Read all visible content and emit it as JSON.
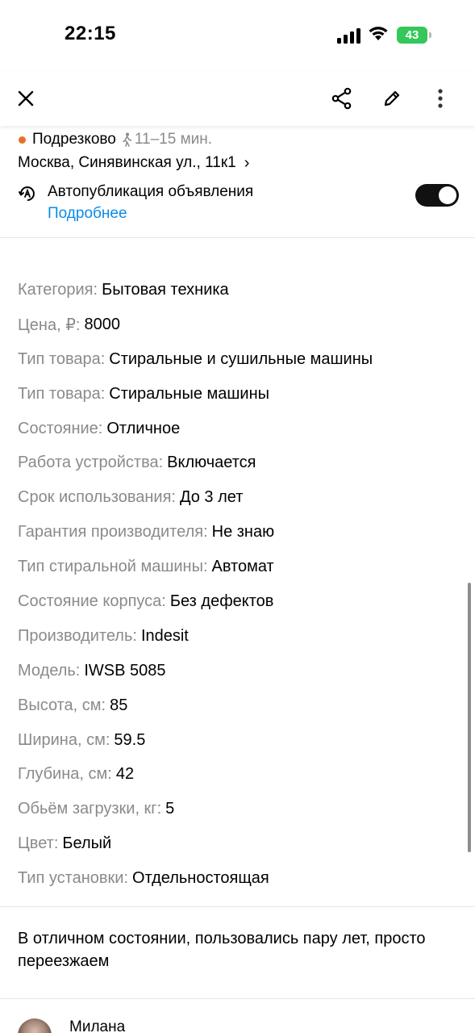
{
  "status": {
    "time": "22:15",
    "battery": "43"
  },
  "toolbar": {
    "close_icon": "close-icon",
    "share_icon": "share-icon",
    "edit_icon": "pencil-icon",
    "more_icon": "more-vertical-icon"
  },
  "location": {
    "metro": "Подрезково",
    "walk_time": "11–15 мин.",
    "address": "Москва, Синявинская ул., 11к1",
    "metro_color": "#e8702a"
  },
  "autopublish": {
    "title": "Автопубликация объявления",
    "link": "Подробнее",
    "enabled": true
  },
  "params": [
    {
      "key": "Категория:",
      "value": "Бытовая техника"
    },
    {
      "key": "Цена, ₽:",
      "value": "8000"
    },
    {
      "key": "Тип товара:",
      "value": "Стиральные и сушильные машины"
    },
    {
      "key": "Тип товара:",
      "value": "Стиральные машины"
    },
    {
      "key": "Состояние:",
      "value": "Отличное"
    },
    {
      "key": "Работа устройства:",
      "value": "Включается"
    },
    {
      "key": "Срок использования:",
      "value": "До 3 лет"
    },
    {
      "key": "Гарантия производителя:",
      "value": "Не знаю"
    },
    {
      "key": "Тип стиральной машины:",
      "value": "Автомат"
    },
    {
      "key": "Состояние корпуса:",
      "value": "Без дефектов"
    },
    {
      "key": "Производитель:",
      "value": "Indesit"
    },
    {
      "key": "Модель:",
      "value": "IWSB 5085"
    },
    {
      "key": "Высота, см:",
      "value": "85"
    },
    {
      "key": "Ширина, см:",
      "value": "59.5"
    },
    {
      "key": "Глубина, см:",
      "value": "42"
    },
    {
      "key": "Обьём загрузки, кг:",
      "value": "5"
    },
    {
      "key": "Цвет:",
      "value": "Белый"
    },
    {
      "key": "Тип установки:",
      "value": "Отдельностоящая"
    }
  ],
  "description": "В отличном состоянии, пользовались пару лет, просто переезжаем",
  "seller": {
    "name": "Милана"
  },
  "colors": {
    "accent_link": "#0a8ce6",
    "battery_green": "#34c759",
    "muted_text": "#8a8a8a"
  }
}
